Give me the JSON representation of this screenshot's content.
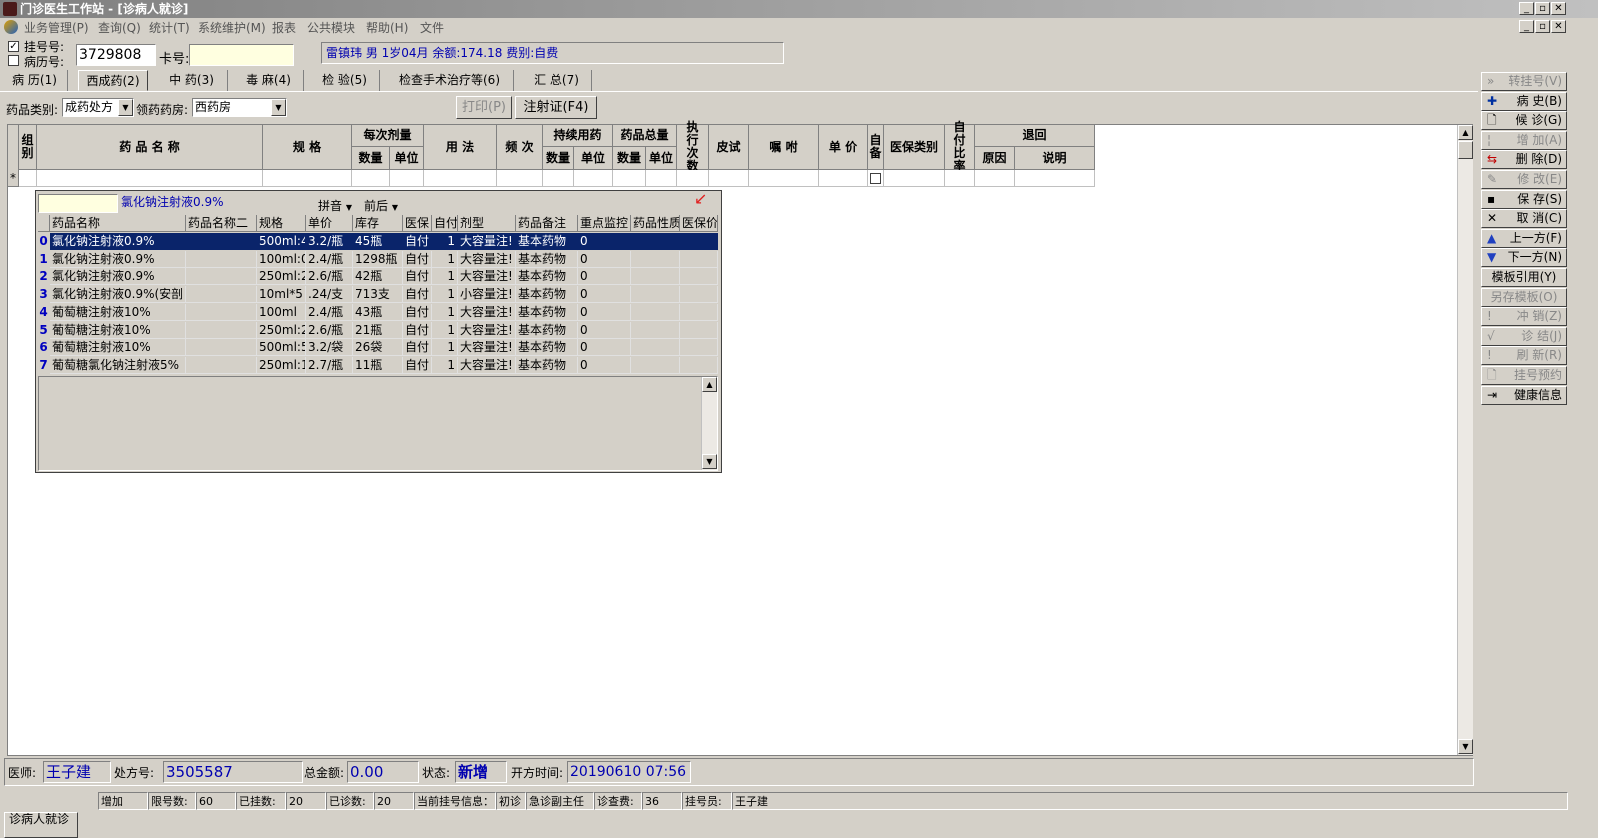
{
  "window": {
    "title": "门诊医生工作站 - [诊病人就诊]"
  },
  "menu": [
    "业务管理(P)",
    "查询(Q)",
    "统计(T)",
    "系统维护(M)",
    "报表",
    "公共模块",
    "帮助(H)",
    "文件"
  ],
  "header": {
    "reg_label": "挂号号:",
    "record_label": "病历号:",
    "reg_value": "3729808",
    "card_label": "卡号:",
    "card_value": "",
    "patient_info": "雷镇玮 男 1岁04月 余额:174.18 费别:自费"
  },
  "tabs": [
    "病 历(1)",
    "西成药(2)",
    "中 药(3)",
    "毒 麻(4)",
    "检 验(5)",
    "检查手术治疗等(6)",
    "汇 总(7)"
  ],
  "toolbar": {
    "drug_type_label": "药品类别:",
    "drug_type_value": "成药处方",
    "pharmacy_label": "领药药房:",
    "pharmacy_value": "西药房",
    "print_label": "打印(P)",
    "inject_label": "注射证(F4)"
  },
  "grid": {
    "headers": {
      "group": "组别",
      "name": "药 品 名 称",
      "spec": "规  格",
      "dose": "每次剂量",
      "qty": "数量",
      "unit": "单位",
      "usage": "用 法",
      "freq": "频 次",
      "cont": "持续用药",
      "total": "药品总量",
      "exec": "执行次数",
      "skin": "皮试",
      "advice": "嘱 咐",
      "price": "单 价",
      "self": "自备",
      "ins_type": "医保类别",
      "pay_ratio": "自付比率",
      "return": "退回",
      "reason": "原因",
      "note": "说明"
    },
    "new_row_marker": "*"
  },
  "popup": {
    "search_value": "",
    "query_text": "氯化钠注射液0.9%",
    "pinyin_label": "拼音",
    "order_label": "前后",
    "columns": [
      "药品名称",
      "药品名称二",
      "规格",
      "单价",
      "库存",
      "医保",
      "自付",
      "剂型",
      "药品备注",
      "重点监控",
      "药品性质",
      "医保价"
    ],
    "rows": [
      {
        "n": "0",
        "name": "氯化钠注射液0.9%",
        "name2": "",
        "spec": "500ml:4",
        "price": "3.2/瓶",
        "stock": "45瓶",
        "ins": "自付",
        "pay": "1",
        "form": "大容量注!",
        "note": "基本药物",
        "key": "0",
        "prop": "",
        "insp": ""
      },
      {
        "n": "1",
        "name": "氯化钠注射液0.9%",
        "name2": "",
        "spec": "100ml:0",
        "price": "2.4/瓶",
        "stock": "1298瓶",
        "ins": "自付",
        "pay": "1",
        "form": "大容量注!",
        "note": "基本药物",
        "key": "0",
        "prop": "",
        "insp": ""
      },
      {
        "n": "2",
        "name": "氯化钠注射液0.9%",
        "name2": "",
        "spec": "250ml:2",
        "price": "2.6/瓶",
        "stock": "42瓶",
        "ins": "自付",
        "pay": "1",
        "form": "大容量注!",
        "note": "基本药物",
        "key": "0",
        "prop": "",
        "insp": ""
      },
      {
        "n": "3",
        "name": "氯化钠注射液0.9%(安剖",
        "name2": "",
        "spec": "10ml*5",
        "price": ".24/支",
        "stock": "713支",
        "ins": "自付",
        "pay": "1",
        "form": "小容量注!",
        "note": "基本药物",
        "key": "0",
        "prop": "",
        "insp": ""
      },
      {
        "n": "4",
        "name": "葡萄糖注射液10%",
        "name2": "",
        "spec": "100ml",
        "price": "2.4/瓶",
        "stock": "43瓶",
        "ins": "自付",
        "pay": "1",
        "form": "大容量注!",
        "note": "基本药物",
        "key": "0",
        "prop": "",
        "insp": ""
      },
      {
        "n": "5",
        "name": "葡萄糖注射液10%",
        "name2": "",
        "spec": "250ml:2",
        "price": "2.6/瓶",
        "stock": "21瓶",
        "ins": "自付",
        "pay": "1",
        "form": "大容量注!",
        "note": "基本药物",
        "key": "0",
        "prop": "",
        "insp": ""
      },
      {
        "n": "6",
        "name": "葡萄糖注射液10%",
        "name2": "",
        "spec": "500ml:5",
        "price": "3.2/袋",
        "stock": "26袋",
        "ins": "自付",
        "pay": "1",
        "form": "大容量注!",
        "note": "基本药物",
        "key": "0",
        "prop": "",
        "insp": ""
      },
      {
        "n": "7",
        "name": "葡萄糖氯化钠注射液5%",
        "name2": "",
        "spec": "250ml:1",
        "price": "2.7/瓶",
        "stock": "11瓶",
        "ins": "自付",
        "pay": "1",
        "form": "大容量注!",
        "note": "基本药物",
        "key": "0",
        "prop": "",
        "insp": ""
      }
    ]
  },
  "side_buttons": [
    {
      "label": "转挂号(V)",
      "icon": "»",
      "enabled": false
    },
    {
      "label": "病  史(B)",
      "icon": "✚",
      "enabled": true
    },
    {
      "label": "候  诊(G)",
      "icon": "🗋",
      "enabled": true
    },
    {
      "label": "增  加(A)",
      "icon": "¦",
      "enabled": false
    },
    {
      "label": "删  除(D)",
      "icon": "⇆",
      "enabled": true
    },
    {
      "label": "修  改(E)",
      "icon": "✎",
      "enabled": false
    },
    {
      "label": "保  存(S)",
      "icon": "▪",
      "enabled": true
    },
    {
      "label": "取  消(C)",
      "icon": "✕",
      "enabled": true
    },
    {
      "label": "上一方(F)",
      "icon": "▲",
      "enabled": true
    },
    {
      "label": "下一方(N)",
      "icon": "▼",
      "enabled": true
    },
    {
      "label": "模板引用(Y)",
      "icon": "",
      "enabled": true
    },
    {
      "label": "另存模板(O)",
      "icon": "",
      "enabled": false
    },
    {
      "label": "冲  销(Z)",
      "icon": "!",
      "enabled": false
    },
    {
      "label": "诊  结(J)",
      "icon": "√",
      "enabled": false
    },
    {
      "label": "刷  新(R)",
      "icon": "!",
      "enabled": false
    },
    {
      "label": "挂号预约",
      "icon": "🗋",
      "enabled": false
    },
    {
      "label": "健康信息",
      "icon": "⇥",
      "enabled": true
    }
  ],
  "footer": {
    "doctor_label": "医师:",
    "doctor_value": "王子建",
    "rx_label": "处方号:",
    "rx_value": "3505587",
    "total_label": "总金额:",
    "total_value": "0.00",
    "state_label": "状态:",
    "state_value": "新增",
    "time_label": "开方时间:",
    "time_value": "20190610 07:56"
  },
  "status": {
    "mode": "增加",
    "limit_label": "限号数:",
    "limit_value": "60",
    "registered_label": "已挂数:",
    "registered_value": "20",
    "seen_label": "已诊数:",
    "seen_value": "20",
    "current_label": "当前挂号信息：",
    "visit_type": "初诊",
    "doctor_level": "急诊副主任",
    "fee_label": "诊查费:",
    "fee_value": "36",
    "clerk_label": "挂号员:",
    "clerk_value": "王子建"
  },
  "window_tab": "诊病人就诊"
}
